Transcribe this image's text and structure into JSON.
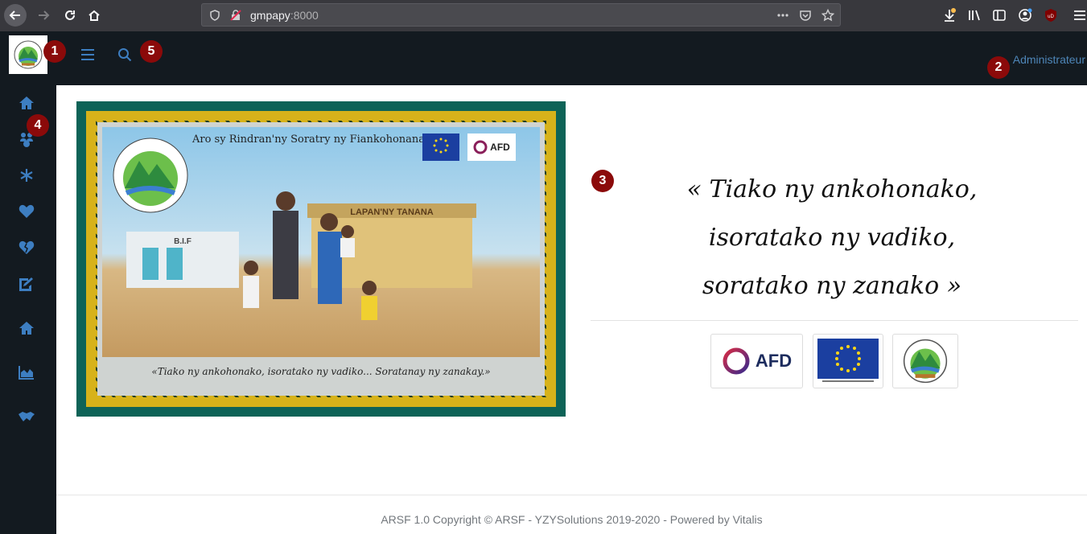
{
  "browser": {
    "url_host": "gmpapy",
    "url_port": ":8000"
  },
  "header": {
    "admin_label": "Administrateur"
  },
  "sidebar": {
    "items": [
      {
        "icon": "home-icon"
      },
      {
        "icon": "people-icon"
      },
      {
        "icon": "snowflake-icon"
      },
      {
        "icon": "heart-icon"
      },
      {
        "icon": "broken-heart-icon"
      },
      {
        "icon": "edit-document-icon"
      },
      {
        "icon": "home-icon"
      },
      {
        "icon": "area-chart-icon"
      },
      {
        "icon": "handshake-icon"
      }
    ]
  },
  "banner": {
    "org_name": "Aro sy Rindran'ny Soratry ny Fiankohonana",
    "caption": "«Tiako ny ankohonako, isoratako ny vadiko... Soratanay ny zanakay.»",
    "afd_label": "AFD",
    "sign_text": "LAPAN'NY TANANA",
    "building_text": "B.I.F"
  },
  "quote": {
    "line1": "« Tiako ny ankohonako,",
    "line2": "isoratako ny vadiko,",
    "line3": "soratako ny zanako »"
  },
  "partners": {
    "afd_label": "AFD"
  },
  "footer": {
    "text": "ARSF 1.0 Copyright © ARSF - YZYSolutions 2019-2020 - Powered by Vitalis"
  },
  "markers": [
    "1",
    "2",
    "3",
    "4",
    "5"
  ],
  "colors": {
    "header_bg": "#131a20",
    "sidebar_icon": "#3d7ec1",
    "link": "#4e86b8",
    "marker": "#8b0a0a"
  }
}
